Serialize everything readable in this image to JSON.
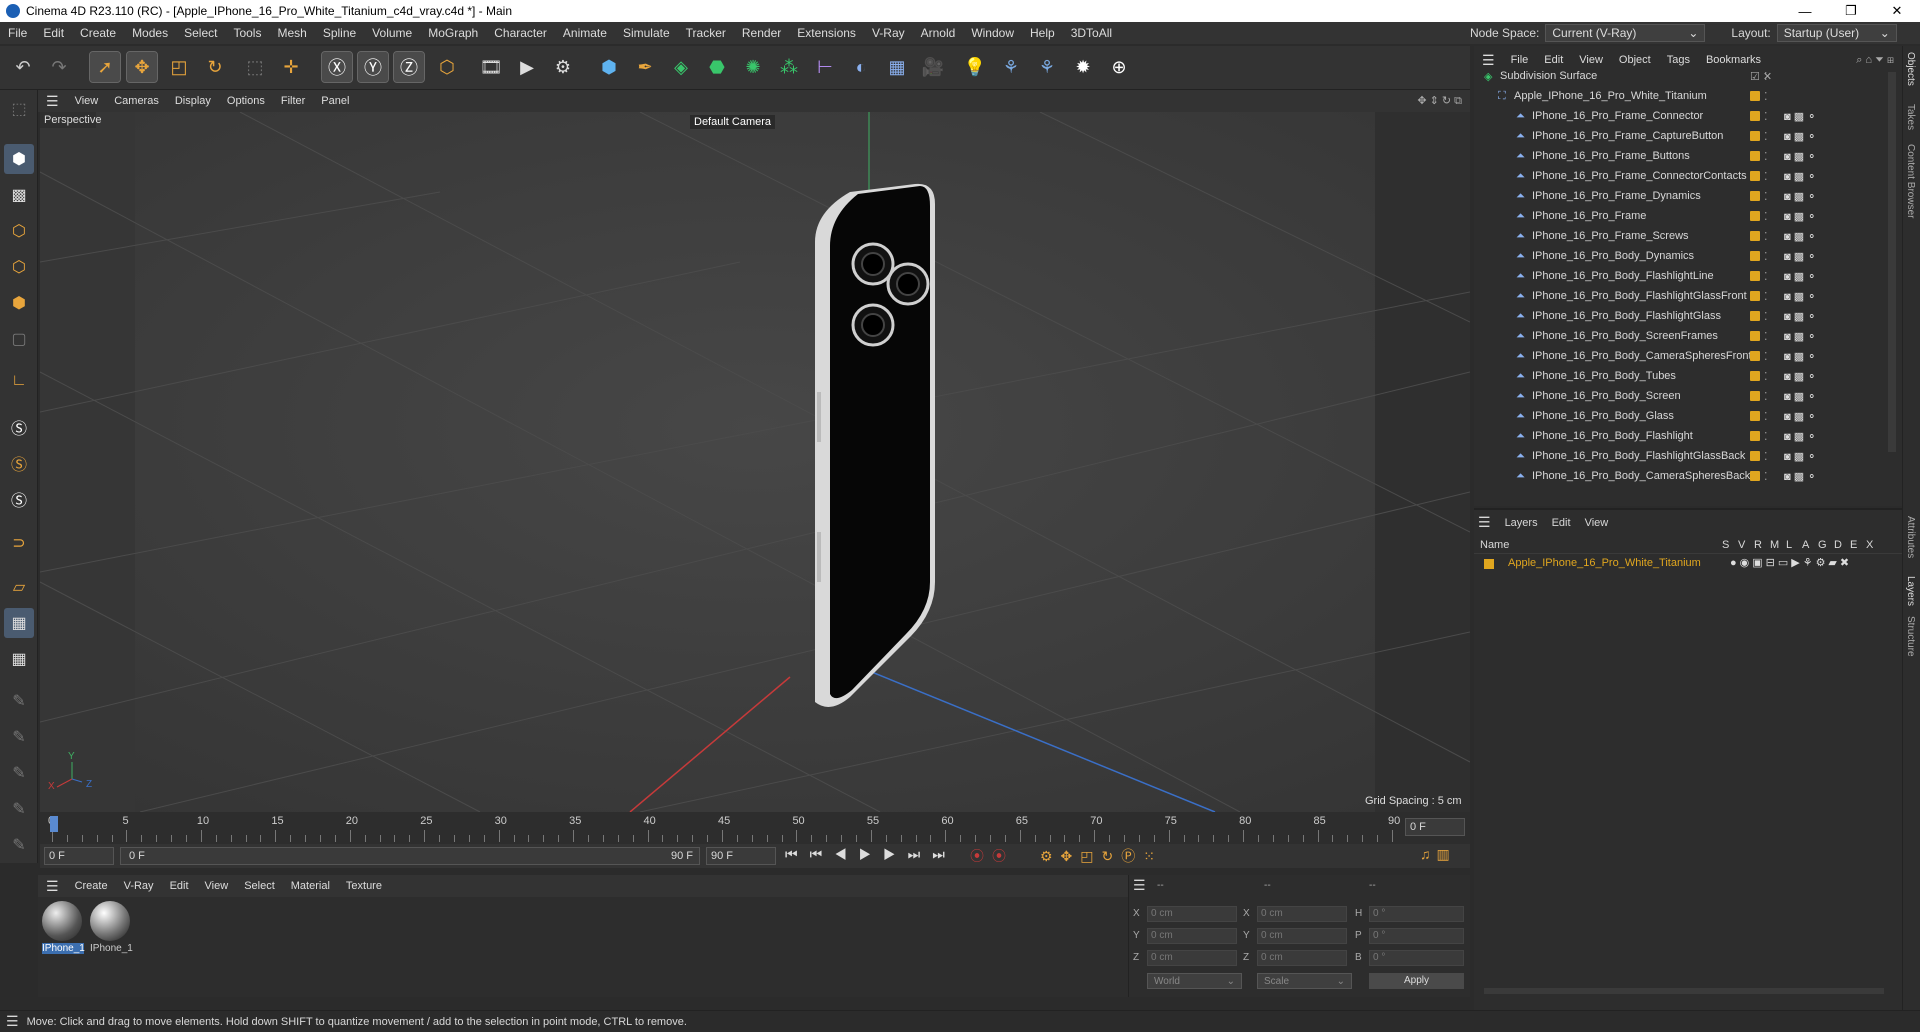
{
  "window": {
    "title": "Cinema 4D R23.110 (RC) - [Apple_IPhone_16_Pro_White_Titanium_c4d_vray.c4d *] - Main",
    "controls": [
      "—",
      "❐",
      "✕"
    ]
  },
  "menubar": [
    "File",
    "Edit",
    "Create",
    "Modes",
    "Select",
    "Tools",
    "Mesh",
    "Spline",
    "Volume",
    "MoGraph",
    "Character",
    "Animate",
    "Simulate",
    "Tracker",
    "Render",
    "Extensions",
    "V-Ray",
    "Arnold",
    "Window",
    "Help",
    "3DToAll"
  ],
  "nodespace": {
    "label": "Node Space:",
    "value": "Current (V-Ray)",
    "layout_label": "Layout:",
    "layout_value": "Startup (User)"
  },
  "viewport": {
    "menu": [
      "View",
      "Cameras",
      "Display",
      "Options",
      "Filter",
      "Panel"
    ],
    "name": "Perspective",
    "camera": "Default Camera",
    "grid_spacing": "Grid Spacing : 5 cm",
    "axes": [
      "Y",
      "X",
      "Z"
    ]
  },
  "objects": {
    "menu": [
      "File",
      "Edit",
      "View",
      "Object",
      "Tags",
      "Bookmarks"
    ],
    "items": [
      {
        "name": "Subdivision Surface",
        "level": 0
      },
      {
        "name": "Apple_IPhone_16_Pro_White_Titanium",
        "level": 1
      },
      {
        "name": "IPhone_16_Pro_Frame_Connector",
        "level": 2
      },
      {
        "name": "IPhone_16_Pro_Frame_CaptureButton",
        "level": 2
      },
      {
        "name": "IPhone_16_Pro_Frame_Buttons",
        "level": 2
      },
      {
        "name": "IPhone_16_Pro_Frame_ConnectorContacts",
        "level": 2
      },
      {
        "name": "IPhone_16_Pro_Frame_Dynamics",
        "level": 2
      },
      {
        "name": "IPhone_16_Pro_Frame",
        "level": 2
      },
      {
        "name": "IPhone_16_Pro_Frame_Screws",
        "level": 2
      },
      {
        "name": "IPhone_16_Pro_Body_Dynamics",
        "level": 2
      },
      {
        "name": "IPhone_16_Pro_Body_FlashlightLine",
        "level": 2
      },
      {
        "name": "IPhone_16_Pro_Body_FlashlightGlassFront",
        "level": 2
      },
      {
        "name": "IPhone_16_Pro_Body_FlashlightGlass",
        "level": 2
      },
      {
        "name": "IPhone_16_Pro_Body_ScreenFrames",
        "level": 2
      },
      {
        "name": "IPhone_16_Pro_Body_CameraSpheresFront",
        "level": 2
      },
      {
        "name": "IPhone_16_Pro_Body_Tubes",
        "level": 2
      },
      {
        "name": "IPhone_16_Pro_Body_Screen",
        "level": 2
      },
      {
        "name": "IPhone_16_Pro_Body_Glass",
        "level": 2
      },
      {
        "name": "IPhone_16_Pro_Body_Flashlight",
        "level": 2
      },
      {
        "name": "IPhone_16_Pro_Body_FlashlightGlassBack",
        "level": 2
      },
      {
        "name": "IPhone_16_Pro_Body_CameraSpheresBack",
        "level": 2
      }
    ]
  },
  "layers": {
    "menu": [
      "Layers",
      "Edit",
      "View"
    ],
    "columns": [
      "Name",
      "S",
      "V",
      "R",
      "M",
      "L",
      "A",
      "G",
      "D",
      "E",
      "X"
    ],
    "row": "Apple_IPhone_16_Pro_White_Titanium"
  },
  "side_tabs": [
    "Objects",
    "Takes",
    "Content Browser",
    "Attributes",
    "Layers",
    "Structure"
  ],
  "timeline": {
    "ticks": [
      "0",
      "5",
      "10",
      "15",
      "20",
      "25",
      "30",
      "35",
      "40",
      "45",
      "50",
      "55",
      "60",
      "65",
      "70",
      "75",
      "80",
      "85",
      "90"
    ],
    "current": "0 F",
    "start": "0 F",
    "range_start": "0 F",
    "range_end": "90 F",
    "end": "90 F",
    "end2": "0 F"
  },
  "materials": {
    "menu": [
      "Create",
      "V-Ray",
      "Edit",
      "View",
      "Select",
      "Material",
      "Texture"
    ],
    "items": [
      "IPhone_1",
      "IPhone_1"
    ]
  },
  "coords": {
    "rows": [
      {
        "a": "X",
        "av": "0 cm",
        "b": "X",
        "bv": "0 cm",
        "c": "H",
        "cv": "0 °"
      },
      {
        "a": "Y",
        "av": "0 cm",
        "b": "Y",
        "bv": "0 cm",
        "c": "P",
        "cv": "0 °"
      },
      {
        "a": "Z",
        "av": "0 cm",
        "b": "Z",
        "bv": "0 cm",
        "c": "B",
        "cv": "0 °"
      }
    ],
    "world": "World",
    "scale": "Scale",
    "apply": "Apply",
    "hdr": [
      "--",
      "--",
      "--"
    ]
  },
  "status": "Move: Click and drag to move elements. Hold down SHIFT to quantize movement / add to the selection in point mode, CTRL to remove.",
  "colors": {
    "accent": "#e0a61f",
    "bg": "#2b2b2b",
    "viewport": "#3d3d3d",
    "layer_name": "#e0a61f"
  }
}
